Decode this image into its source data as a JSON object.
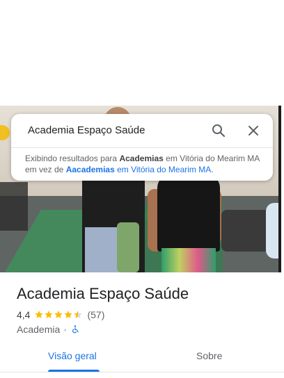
{
  "search": {
    "query": "Academia Espaço Saúde"
  },
  "notice": {
    "prefix": "Exibindo resultados para",
    "shown_term": "Academias",
    "shown_location": "em Vitória do Mearim MA em vez de",
    "original_term": "Aacademias",
    "original_location": "em Vitória do Mearim MA",
    "suffix": "."
  },
  "place": {
    "name": "Academia Espaço Saúde",
    "rating": "4,4",
    "stars": 4.4,
    "review_count": "(57)",
    "category": "Academia",
    "separator": "·",
    "accessibility_icon": "wheelchair-icon"
  },
  "tabs": [
    {
      "label": "Visão geral",
      "active": true
    },
    {
      "label": "Sobre",
      "active": false
    }
  ],
  "colors": {
    "accent": "#1a73e8",
    "star": "#fbbc04",
    "text": "#202124",
    "muted": "#5f6368"
  }
}
